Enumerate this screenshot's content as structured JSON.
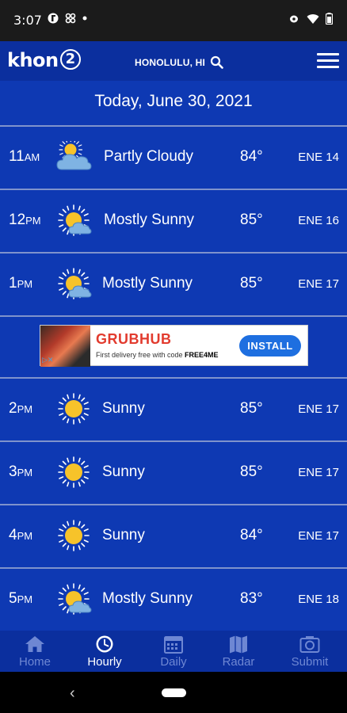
{
  "status_bar": {
    "time": "3:07"
  },
  "header": {
    "logo_text": "khon",
    "logo_number": "2",
    "location": "HONOLULU, HI"
  },
  "main": {
    "date_title": "Today, June 30, 2021",
    "rows": [
      {
        "hour": "11",
        "ampm": "AM",
        "icon": "partly-cloudy-icon",
        "condition": "Partly Cloudy",
        "temp": "84°",
        "wind": "ENE 14"
      },
      {
        "hour": "12",
        "ampm": "PM",
        "icon": "mostly-sunny-icon",
        "condition": "Mostly Sunny",
        "temp": "85°",
        "wind": "ENE 16"
      },
      {
        "hour": "1",
        "ampm": "PM",
        "icon": "mostly-sunny-icon",
        "condition": "Mostly Sunny",
        "temp": "85°",
        "wind": "ENE 17"
      },
      {
        "hour": "2",
        "ampm": "PM",
        "icon": "sunny-icon",
        "condition": "Sunny",
        "temp": "85°",
        "wind": "ENE 17"
      },
      {
        "hour": "3",
        "ampm": "PM",
        "icon": "sunny-icon",
        "condition": "Sunny",
        "temp": "85°",
        "wind": "ENE 17"
      },
      {
        "hour": "4",
        "ampm": "PM",
        "icon": "sunny-icon",
        "condition": "Sunny",
        "temp": "84°",
        "wind": "ENE 17"
      },
      {
        "hour": "5",
        "ampm": "PM",
        "icon": "mostly-sunny-icon",
        "condition": "Mostly Sunny",
        "temp": "83°",
        "wind": "ENE 18"
      }
    ]
  },
  "ad": {
    "brand": "GRUBHUB",
    "sub_prefix": "First delivery free with code ",
    "code": "FREE4ME",
    "button": "INSTALL"
  },
  "bottom_nav": {
    "items": [
      {
        "label": "Home",
        "icon": "home-icon"
      },
      {
        "label": "Hourly",
        "icon": "clock-icon"
      },
      {
        "label": "Daily",
        "icon": "calendar-icon"
      },
      {
        "label": "Radar",
        "icon": "map-icon"
      },
      {
        "label": "Submit",
        "icon": "camera-icon"
      }
    ],
    "active": "Hourly"
  },
  "colors": {
    "header": "#0b2f9e",
    "main": "#0e39b3",
    "divider": "#7f93cc",
    "sun": "#f7c32a",
    "ad_button": "#1e6fe0",
    "ad_brand": "#e23b2e"
  }
}
